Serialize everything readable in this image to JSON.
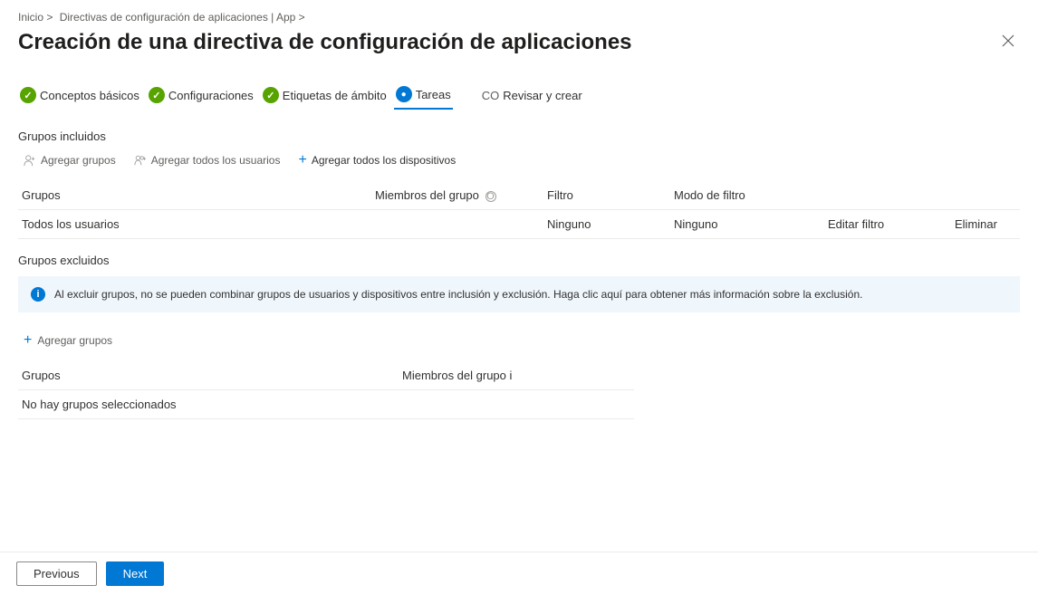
{
  "breadcrumb": {
    "home": "Inicio >",
    "policies": "Directivas de configuración de aplicaciones | App >"
  },
  "page_title": "Creación de una directiva de configuración de aplicaciones",
  "stepper": {
    "step1": "Conceptos básicos",
    "step2": "Configuraciones",
    "step3": "Etiquetas de ámbito",
    "step4": "Tareas",
    "step5_prefix": "CO",
    "step5": "Revisar y crear"
  },
  "included": {
    "heading": "Grupos incluidos",
    "add_groups": "Agregar grupos",
    "add_all_users": "Agregar todos los usuarios",
    "add_all_devices": "Agregar todos los dispositivos",
    "columns": {
      "groups": "Grupos",
      "members": "Miembros del grupo",
      "filter": "Filtro",
      "filter_mode": "Modo de filtro"
    },
    "row": {
      "group": "Todos los usuarios",
      "members": "",
      "filter": "Ninguno",
      "filter_mode": "Ninguno",
      "edit_filter": "Editar filtro",
      "remove": "Eliminar"
    }
  },
  "excluded": {
    "heading": "Grupos excluidos",
    "info_text": "Al excluir grupos, no se pueden combinar grupos de usuarios y dispositivos entre inclusión y exclusión. Haga clic aquí para obtener más información sobre la exclusión.",
    "add_groups": "Agregar grupos",
    "columns": {
      "groups": "Grupos",
      "members": "Miembros del grupo"
    },
    "empty": "No hay grupos seleccionados"
  },
  "footer": {
    "previous": "Previous",
    "next": "Next"
  }
}
